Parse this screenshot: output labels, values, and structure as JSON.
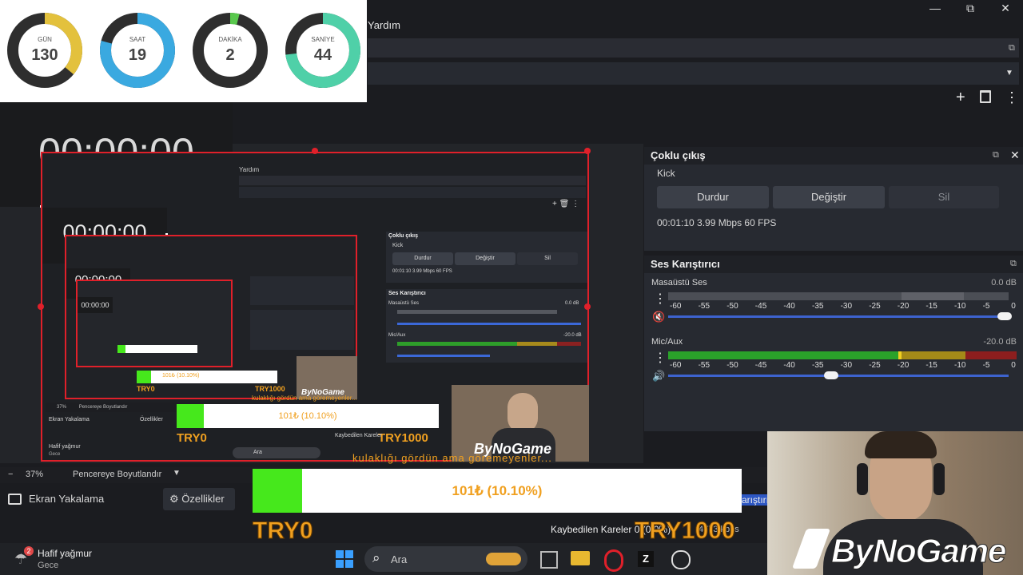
{
  "window": {
    "menu_help": "Yardım",
    "minimize": "—",
    "maximize": "⧉",
    "close": "✕"
  },
  "countdown": {
    "items": [
      {
        "label": "GÜN",
        "value": "130",
        "fraction": 0.36,
        "color": "#e3c13d"
      },
      {
        "label": "SAAT",
        "value": "19",
        "fraction": 0.79,
        "color": "#3aa9e0"
      },
      {
        "label": "DAKİKA",
        "value": "2",
        "fraction": 0.04,
        "color": "#59c84d"
      },
      {
        "label": "SANİYE",
        "value": "44",
        "fraction": 0.73,
        "color": "#4fd0a8"
      }
    ]
  },
  "stopwatch": {
    "main": "00:00:00",
    "sub": "00:00:00"
  },
  "multi_output": {
    "title": "Çoklu çıkış",
    "target": "Kick",
    "stop": "Durdur",
    "change": "Değiştir",
    "delete": "Sil",
    "stats": "00:01:10  3.99 Mbps  60 FPS"
  },
  "mixer": {
    "title": "Ses Karıştırıcı",
    "scale": [
      "-60",
      "-55",
      "-50",
      "-45",
      "-40",
      "-35",
      "-30",
      "-25",
      "-20",
      "-15",
      "-10",
      "-5",
      "0"
    ],
    "channels": [
      {
        "name": "Masaüstü Ses",
        "db": "0.0 dB",
        "volume": 1.0,
        "muted": true
      },
      {
        "name": "Mic/Aux",
        "db": "-20.0 dB",
        "volume": 0.49,
        "muted": false
      }
    ]
  },
  "preview_bar": {
    "zoom": "37%",
    "fit": "Pencereye Boyutlandır"
  },
  "sources": {
    "capture": "Ekran Yakalama",
    "properties": "Özellikler",
    "mixer_short": "arıştırı"
  },
  "status": {
    "dropped": "Kaybedilen Kareler 0 (0.0%)",
    "kbps": "4773 kbps"
  },
  "donation": {
    "text": "101₺ (10.10%)",
    "fraction": 0.101,
    "left": "TRY0",
    "right": "TRY1000",
    "ticker": "kulaklığı gördün ama göremeyenler..."
  },
  "nested_preview": {
    "help": "Yardım",
    "multi": "Çoklu çıkış",
    "kick": "Kick",
    "stop": "Durdur",
    "change": "Değiştir",
    "delete": "Sil",
    "stats": "00:01:10  3.99 Mbps  60 FPS",
    "mixer": "Ses Karıştırıcı",
    "desktop": "Masaüstü Ses",
    "mic": "Mic/Aux",
    "db1": "0.0 dB",
    "db2": "-20.0 dB",
    "fit": "Pencereye Boyutlandır",
    "zoom": "37%",
    "capture": "Ekran Yakalama",
    "props": "Özellikler",
    "dropped": "Kaybedilen Kareler",
    "weather": "Hafif yağmur",
    "weather_sub": "Gece",
    "search": "Ara"
  },
  "taskbar": {
    "weather": "Hafif yağmur",
    "weather_sub": "Gece",
    "badge": "2",
    "search": "Ara"
  },
  "brand": {
    "logo": "ByNoGame"
  },
  "icons": {
    "plus": "+",
    "trash": "🗑",
    "more": "⋮",
    "gear": "⚙",
    "speaker": "🔊",
    "windows": "⊞",
    "search": "⌕"
  }
}
